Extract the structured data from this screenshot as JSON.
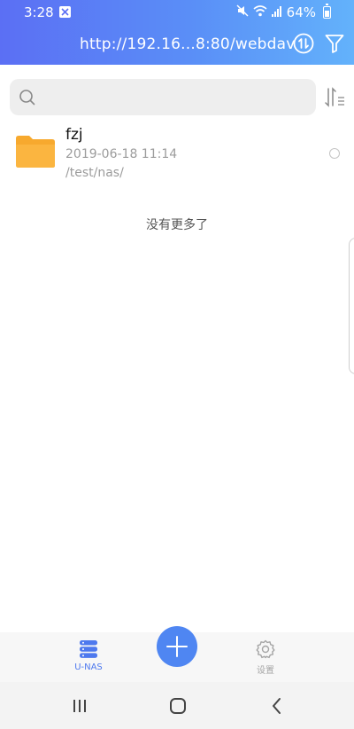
{
  "status": {
    "time": "3:28",
    "battery": "64%"
  },
  "header": {
    "url": "http://192.16...8:80/webdav"
  },
  "search": {
    "placeholder": ""
  },
  "list": {
    "items": [
      {
        "name": "fzj",
        "date": "2019-06-18 11:14",
        "path": "/test/nas/"
      }
    ],
    "end_text": "没有更多了"
  },
  "tabbar": {
    "tabs": [
      {
        "label": "U-NAS",
        "icon": "server-icon",
        "active": true
      },
      {
        "label": "设置",
        "icon": "gear-icon",
        "active": false
      }
    ]
  },
  "colors": {
    "header_start": "#5b6ff4",
    "header_end": "#63b2fb",
    "accent": "#4f86f2",
    "folder": "#fbb540"
  }
}
